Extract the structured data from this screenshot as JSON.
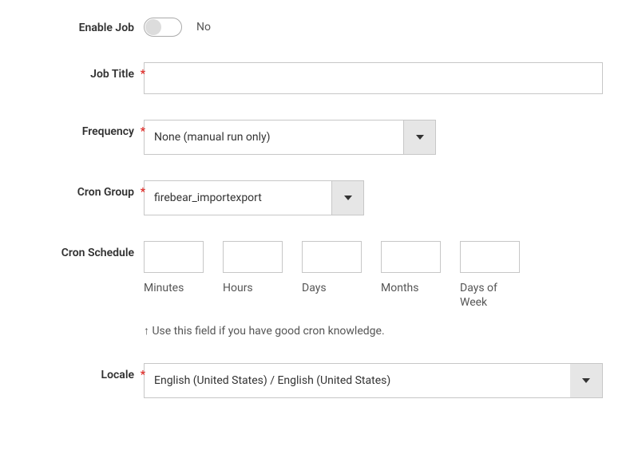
{
  "enable": {
    "label": "Enable Job",
    "value": "No"
  },
  "title": {
    "label": "Job Title",
    "value": ""
  },
  "frequency": {
    "label": "Frequency",
    "value": "None (manual run only)"
  },
  "cronGroup": {
    "label": "Cron Group",
    "value": "firebear_importexport"
  },
  "cronSchedule": {
    "label": "Cron Schedule",
    "cols": {
      "minutes": "Minutes",
      "hours": "Hours",
      "days": "Days",
      "months": "Months",
      "dow": "Days of Week"
    },
    "hint": "↑ Use this field if you have good cron knowledge."
  },
  "locale": {
    "label": "Locale",
    "value": "English (United States) / English (United States)"
  },
  "requiredMark": "*"
}
